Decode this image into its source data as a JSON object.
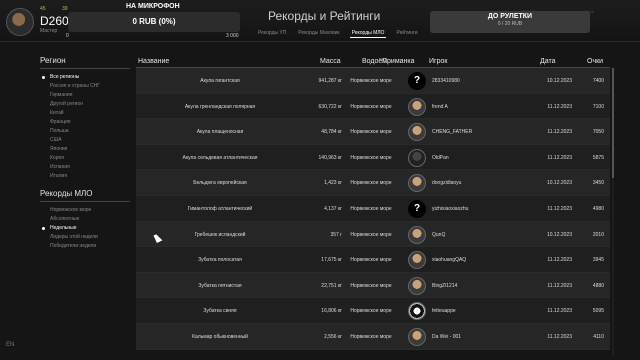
{
  "topbar": {
    "player_name": "D260",
    "player_sub": "Мастер",
    "level_a": "45",
    "level_b": "39",
    "mic_title": "НА МИКРОФОН",
    "mic_value": "0 RUB (0%)",
    "mic_min": "0",
    "mic_max": "3 000",
    "page_title": "Рекорды и Рейтинги",
    "tabs": [
      "Рекорды УП",
      "Рекорды Маховик",
      "Рекорды МЛО",
      "Рейтинги"
    ],
    "active_tab": "Рекорды МЛО",
    "roulette_title": "ДО РУЛЕТКИ",
    "roulette_value": "0 / 20 RUB",
    "faint_left": "1 374 411",
    "faint_right": "6 14"
  },
  "sidebar": {
    "region_title": "Регион",
    "regions": [
      {
        "label": "Все регионы",
        "active": true
      },
      {
        "label": "Россия и страны СНГ",
        "active": false
      },
      {
        "label": "Германия",
        "active": false
      },
      {
        "label": "Другой регион",
        "active": false
      },
      {
        "label": "Китай",
        "active": false
      },
      {
        "label": "Франция",
        "active": false
      },
      {
        "label": "Польша",
        "active": false
      },
      {
        "label": "США",
        "active": false
      },
      {
        "label": "Япония",
        "active": false
      },
      {
        "label": "Корея",
        "active": false
      },
      {
        "label": "Испания",
        "active": false
      },
      {
        "label": "Италия",
        "active": false
      }
    ],
    "records_title": "Рекорды МЛО",
    "records": [
      {
        "label": "Норвежское море",
        "active": false
      },
      {
        "label": "Абсолютные",
        "active": false
      },
      {
        "label": "Недельные",
        "active": true
      },
      {
        "label": "Лидеры этой недели",
        "active": false
      },
      {
        "label": "Победители недели",
        "active": false
      }
    ]
  },
  "table": {
    "headers": {
      "name": "Название",
      "mass": "Масса",
      "water": "Водоём",
      "bait": "Приманка",
      "player": "Игрок",
      "date": "Дата",
      "score": "Очки"
    },
    "rows": [
      {
        "name": "Акула гигантская",
        "mass": "941,287 кг",
        "water": "Норвежское море",
        "bait": "?",
        "avatar": "q",
        "player": "2833410980",
        "date": "10.12.2023",
        "score": "7400"
      },
      {
        "name": "Акула гренландская полярная",
        "mass": "630,722 кг",
        "water": "Норвежское море",
        "bait": "",
        "avatar": "face",
        "player": "frend A",
        "date": "11.12.2023",
        "score": "7100"
      },
      {
        "name": "Акула плащеносная",
        "mass": "48,784 кг",
        "water": "Норвежское море",
        "bait": "",
        "avatar": "face",
        "player": "CHENG_FATHER",
        "date": "11.12.2023",
        "score": "7050"
      },
      {
        "name": "Акула сельдевая атлантическая",
        "mass": "140,963 кг",
        "water": "Норвежское море",
        "bait": "",
        "avatar": "dark",
        "player": "OldPan",
        "date": "11.12.2023",
        "score": "5875"
      },
      {
        "name": "Бельдюга европейская",
        "mass": "1,423 кг",
        "water": "Норвежское море",
        "bait": "",
        "avatar": "face",
        "player": "dongzidiaoyu",
        "date": "10.12.2023",
        "score": "3450"
      },
      {
        "name": "Гимантолоф атлантический",
        "mass": "4,137 кг",
        "water": "Норвежское море",
        "bait": "?",
        "avatar": "q",
        "player": "yizhixiaoxiaozhu",
        "date": "11.12.2023",
        "score": "4980"
      },
      {
        "name": "Гребешок исландский",
        "mass": "357 г",
        "water": "Норвежское море",
        "bait": "",
        "avatar": "face",
        "player": "QunQ",
        "date": "10.12.2023",
        "score": "2010"
      },
      {
        "name": "Зубатка полосатая",
        "mass": "17,675 кг",
        "water": "Норвежское море",
        "bait": "",
        "avatar": "face",
        "player": "xiaohuangQAQ",
        "date": "11.12.2023",
        "score": "3945"
      },
      {
        "name": "Зубатка пятнистая",
        "mass": "22,751 кг",
        "water": "Норвежское море",
        "bait": "",
        "avatar": "face",
        "player": "BingZi1214",
        "date": "11.12.2023",
        "score": "4880"
      },
      {
        "name": "Зубатка синяя",
        "mass": "16,806 кг",
        "water": "Норвежское море",
        "bait": "",
        "avatar": "bw",
        "player": "fetteuappe",
        "date": "11.12.2023",
        "score": "5095"
      },
      {
        "name": "Кальмар обыкновенный",
        "mass": "2,556 кг",
        "water": "Норвежское море",
        "bait": "",
        "avatar": "face",
        "player": "Da Wei - 001",
        "date": "11.12.2023",
        "score": "4110"
      }
    ]
  },
  "footer": {
    "lang": "EN"
  }
}
